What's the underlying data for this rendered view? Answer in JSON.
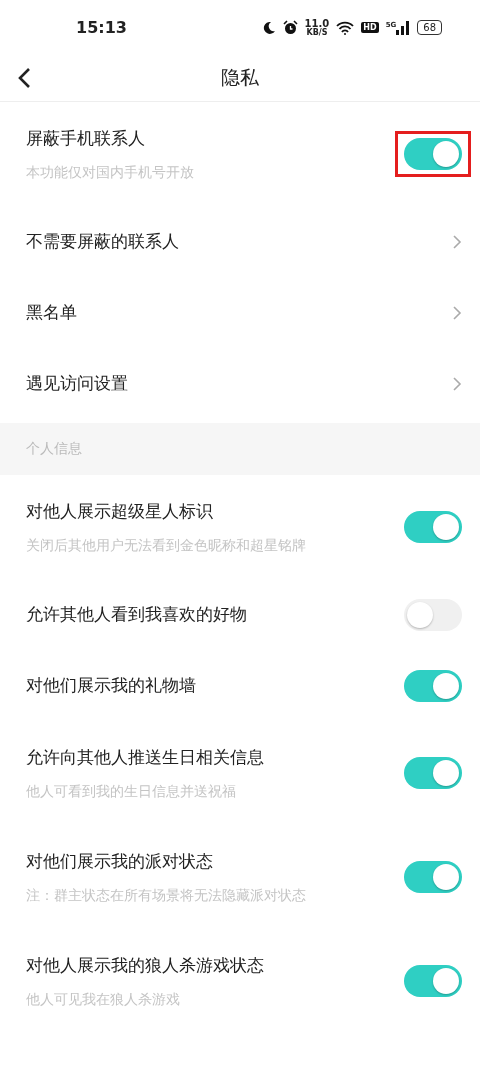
{
  "status_bar": {
    "time": "15:13",
    "net_speed": "11.0",
    "net_unit": "KB/S",
    "hd": "HD",
    "network": "5G",
    "battery": "68"
  },
  "nav": {
    "title": "隐私"
  },
  "sections": [
    {
      "items": [
        {
          "kind": "toggle",
          "label": "屏蔽手机联系人",
          "hint": "本功能仅对国内手机号开放",
          "on": true,
          "highlighted": true
        },
        {
          "kind": "link",
          "label": "不需要屏蔽的联系人"
        },
        {
          "kind": "link",
          "label": "黑名单"
        },
        {
          "kind": "link",
          "label": "遇见访问设置"
        }
      ]
    },
    {
      "header": "个人信息",
      "items": [
        {
          "kind": "toggle",
          "label": "对他人展示超级星人标识",
          "hint": "关闭后其他用户无法看到金色昵称和超星铭牌",
          "on": true
        },
        {
          "kind": "toggle",
          "label": "允许其他人看到我喜欢的好物",
          "on": false
        },
        {
          "kind": "toggle",
          "label": "对他们展示我的礼物墙",
          "on": true
        },
        {
          "kind": "toggle",
          "label": "允许向其他人推送生日相关信息",
          "hint": "他人可看到我的生日信息并送祝福",
          "on": true
        },
        {
          "kind": "toggle",
          "label": "对他们展示我的派对状态",
          "hint": "注：群主状态在所有场景将无法隐藏派对状态",
          "on": true
        },
        {
          "kind": "toggle",
          "label": "对他人展示我的狼人杀游戏状态",
          "hint": "他人可见我在狼人杀游戏",
          "on": true
        }
      ]
    }
  ]
}
